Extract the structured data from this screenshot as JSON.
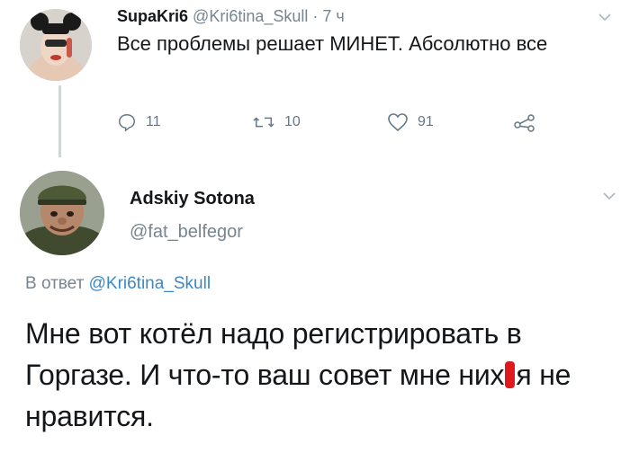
{
  "tweet": {
    "author_name": "SupaKri6",
    "author_handle": "@Kri6tina_Skull",
    "time": "· 7 ч",
    "text": "Все проблемы решает МИНЕТ. Абсолютно все",
    "actions": {
      "replies": "11",
      "retweets": "10",
      "likes": "91"
    }
  },
  "reply": {
    "author_name": "Adskiy Sotona",
    "author_handle": "@fat_belfegor",
    "reply_to_prefix": "В ответ",
    "reply_to_handle": "@Kri6tina_Skull",
    "text_before_censor": "Мне вот котёл надо регистрировать в Горгазе. И что-то ваш совет мне них",
    "text_after_censor": "я не нравится."
  },
  "colors": {
    "name": "#14171a",
    "secondary": "#768590",
    "mention": "#3b88c3",
    "censor_mark": "#e0191f"
  },
  "icons": [
    "reply-icon",
    "retweet-icon",
    "like-icon",
    "share-icon",
    "chevron-down-icon"
  ]
}
